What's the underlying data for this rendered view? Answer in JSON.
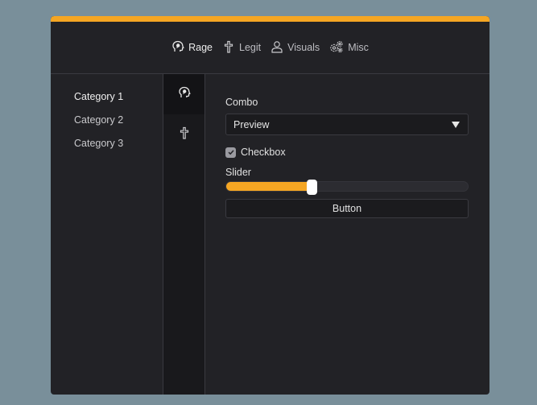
{
  "colors": {
    "accent": "#f5a623",
    "window_bg": "#222226",
    "backdrop": "#798f9a"
  },
  "nav": {
    "tabs": [
      {
        "label": "Rage",
        "icon": "head-icon",
        "active": true
      },
      {
        "label": "Legit",
        "icon": "cross-icon",
        "active": false
      },
      {
        "label": "Visuals",
        "icon": "user-icon",
        "active": false
      },
      {
        "label": "Misc",
        "icon": "gears-icon",
        "active": false
      }
    ]
  },
  "categories": [
    {
      "label": "Category 1",
      "active": true
    },
    {
      "label": "Category 2",
      "active": false
    },
    {
      "label": "Category 3",
      "active": false
    }
  ],
  "rail": [
    {
      "icon": "head-icon",
      "active": true
    },
    {
      "icon": "cross-icon",
      "active": false
    }
  ],
  "controls": {
    "combo_label": "Combo",
    "combo_value": "Preview",
    "checkbox_label": "Checkbox",
    "checkbox_checked": true,
    "slider_label": "Slider",
    "slider_value": 0.35,
    "button_label": "Button"
  }
}
